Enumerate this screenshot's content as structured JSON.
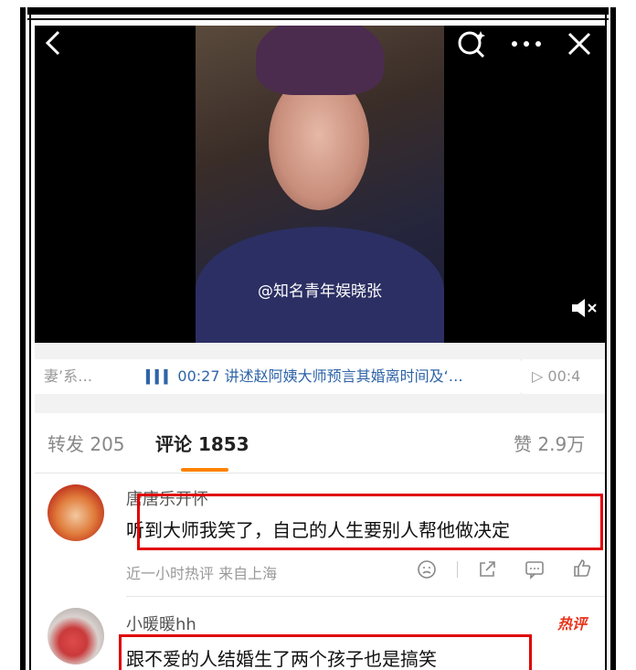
{
  "video": {
    "watermark": "@知名青年娱晓张",
    "icons": [
      "back-icon",
      "search-icon",
      "more-icon",
      "close-icon",
      "mute-icon"
    ]
  },
  "tags": [
    {
      "label": "妻’系…"
    },
    {
      "time": "00:27",
      "label": "讲述赵阿姨大师预言其婚离时间及‘…"
    },
    {
      "time": "00:4"
    }
  ],
  "tabs": {
    "repost_label": "转发",
    "repost_count": "205",
    "comment_label": "评论",
    "comment_count": "1853",
    "like_label": "赞",
    "like_count": "2.9万"
  },
  "comments": [
    {
      "user": "唐唐乐开怀",
      "text": "听到大师我笑了，自己的人生要别人帮他做决定",
      "meta": "近一小时热评  来自上海"
    },
    {
      "user": "小暖暖hh",
      "badge": "热评",
      "text": "跟不爱的人结婚生了两个孩子也是搞笑"
    }
  ],
  "colors": {
    "accent": "#ff8200",
    "highlight_box": "#e00000",
    "link": "#2e64a8"
  }
}
